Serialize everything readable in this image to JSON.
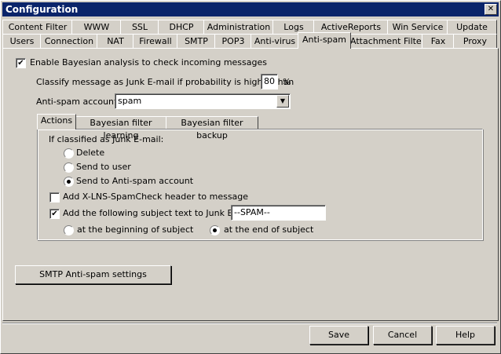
{
  "window": {
    "title": "Configuration",
    "close": "✕"
  },
  "tabs_row1": [
    "Content Filter",
    "WWW",
    "SSL",
    "DHCP",
    "Administration",
    "Logs",
    "ActiveReports",
    "Win Service",
    "Update"
  ],
  "tabs_row2": [
    "Users",
    "Connection",
    "NAT",
    "Firewall",
    "SMTP",
    "POP3",
    "Anti-virus",
    "Anti-spam",
    "Attachment Filter",
    "Fax",
    "Proxy"
  ],
  "active_tab": "Anti-spam",
  "bayesian": {
    "enable_label": "Enable Bayesian analysis to check incoming messages",
    "enabled": true,
    "classify_label": "Classify message as Junk E-mail if probability is higher than",
    "probability": "80",
    "percent": "%",
    "account_label": "Anti-spam account:",
    "account_value": "spam"
  },
  "inner_tabs": [
    "Actions",
    "Bayesian filter learning",
    "Bayesian filter backup"
  ],
  "actions": {
    "if_classified": "If classified as Junk E-mail:",
    "options": [
      "Delete",
      "Send to user",
      "Send to Anti-spam account"
    ],
    "selected_option": 2,
    "add_header_label": "Add X-LNS-SpamCheck header to message",
    "add_header_checked": false,
    "add_subject_label": "Add the following subject text to Junk E-mail:",
    "add_subject_checked": true,
    "subject_text": "--SPAM--",
    "position_options": [
      "at the beginning of subject",
      "at the end of subject"
    ],
    "position_selected": 1
  },
  "smtp_button": "SMTP Anti-spam settings",
  "footer": {
    "save": "Save",
    "cancel": "Cancel",
    "help": "Help"
  }
}
